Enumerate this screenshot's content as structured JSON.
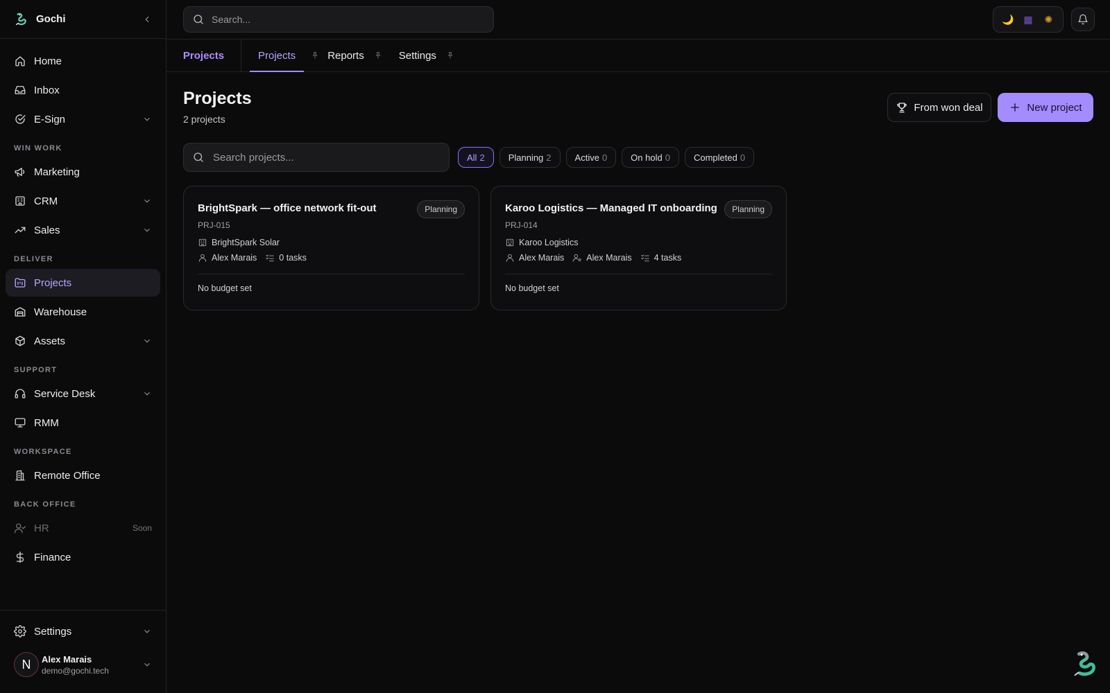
{
  "app": {
    "name": "Gochi"
  },
  "sidebar": {
    "top_items": [
      {
        "label": "Home"
      },
      {
        "label": "Inbox"
      },
      {
        "label": "E-Sign"
      }
    ],
    "sections": [
      {
        "title": "WIN WORK",
        "items": [
          {
            "label": "Marketing"
          },
          {
            "label": "CRM"
          },
          {
            "label": "Sales"
          }
        ]
      },
      {
        "title": "DELIVER",
        "items": [
          {
            "label": "Projects"
          },
          {
            "label": "Warehouse"
          },
          {
            "label": "Assets"
          }
        ]
      },
      {
        "title": "SUPPORT",
        "items": [
          {
            "label": "Service Desk"
          },
          {
            "label": "RMM"
          }
        ]
      },
      {
        "title": "WORKSPACE",
        "items": [
          {
            "label": "Remote Office"
          }
        ]
      },
      {
        "title": "BACK OFFICE",
        "items": [
          {
            "label": "HR",
            "badge": "Soon"
          },
          {
            "label": "Finance"
          }
        ]
      }
    ],
    "settings_label": "Settings",
    "user": {
      "initial": "N",
      "name": "Alex Marais",
      "email": "demo@gochi.tech"
    }
  },
  "topbar": {
    "search_placeholder": "Search...",
    "theme_icons": [
      "🌙",
      "▦",
      "✺"
    ]
  },
  "tabs": {
    "module": "Projects",
    "items": [
      {
        "label": "Projects"
      },
      {
        "label": "Reports"
      },
      {
        "label": "Settings"
      }
    ]
  },
  "page": {
    "title": "Projects",
    "subtitle": "2 projects",
    "from_won_deal_label": "From won deal",
    "new_project_label": "New project",
    "search_placeholder": "Search projects..."
  },
  "filters": [
    {
      "label": "All",
      "count": "2"
    },
    {
      "label": "Planning",
      "count": "2"
    },
    {
      "label": "Active",
      "count": "0"
    },
    {
      "label": "On hold",
      "count": "0"
    },
    {
      "label": "Completed",
      "count": "0"
    }
  ],
  "projects": [
    {
      "title": "BrightSpark — office network fit-out",
      "id": "PRJ-015",
      "status": "Planning",
      "company": "BrightSpark Solar",
      "owner": "Alex Marais",
      "tasks": "0 tasks",
      "budget": "No budget set"
    },
    {
      "title": "Karoo Logistics — Managed IT onboarding",
      "id": "PRJ-014",
      "status": "Planning",
      "company": "Karoo Logistics",
      "owner": "Alex Marais",
      "assignee": "Alex Marais",
      "tasks": "4 tasks",
      "budget": "No budget set"
    }
  ],
  "colors": {
    "accent": "#a48cff",
    "accent_text": "#b7a4ff",
    "background": "#0b0b0c",
    "border": "#2e2e32"
  }
}
